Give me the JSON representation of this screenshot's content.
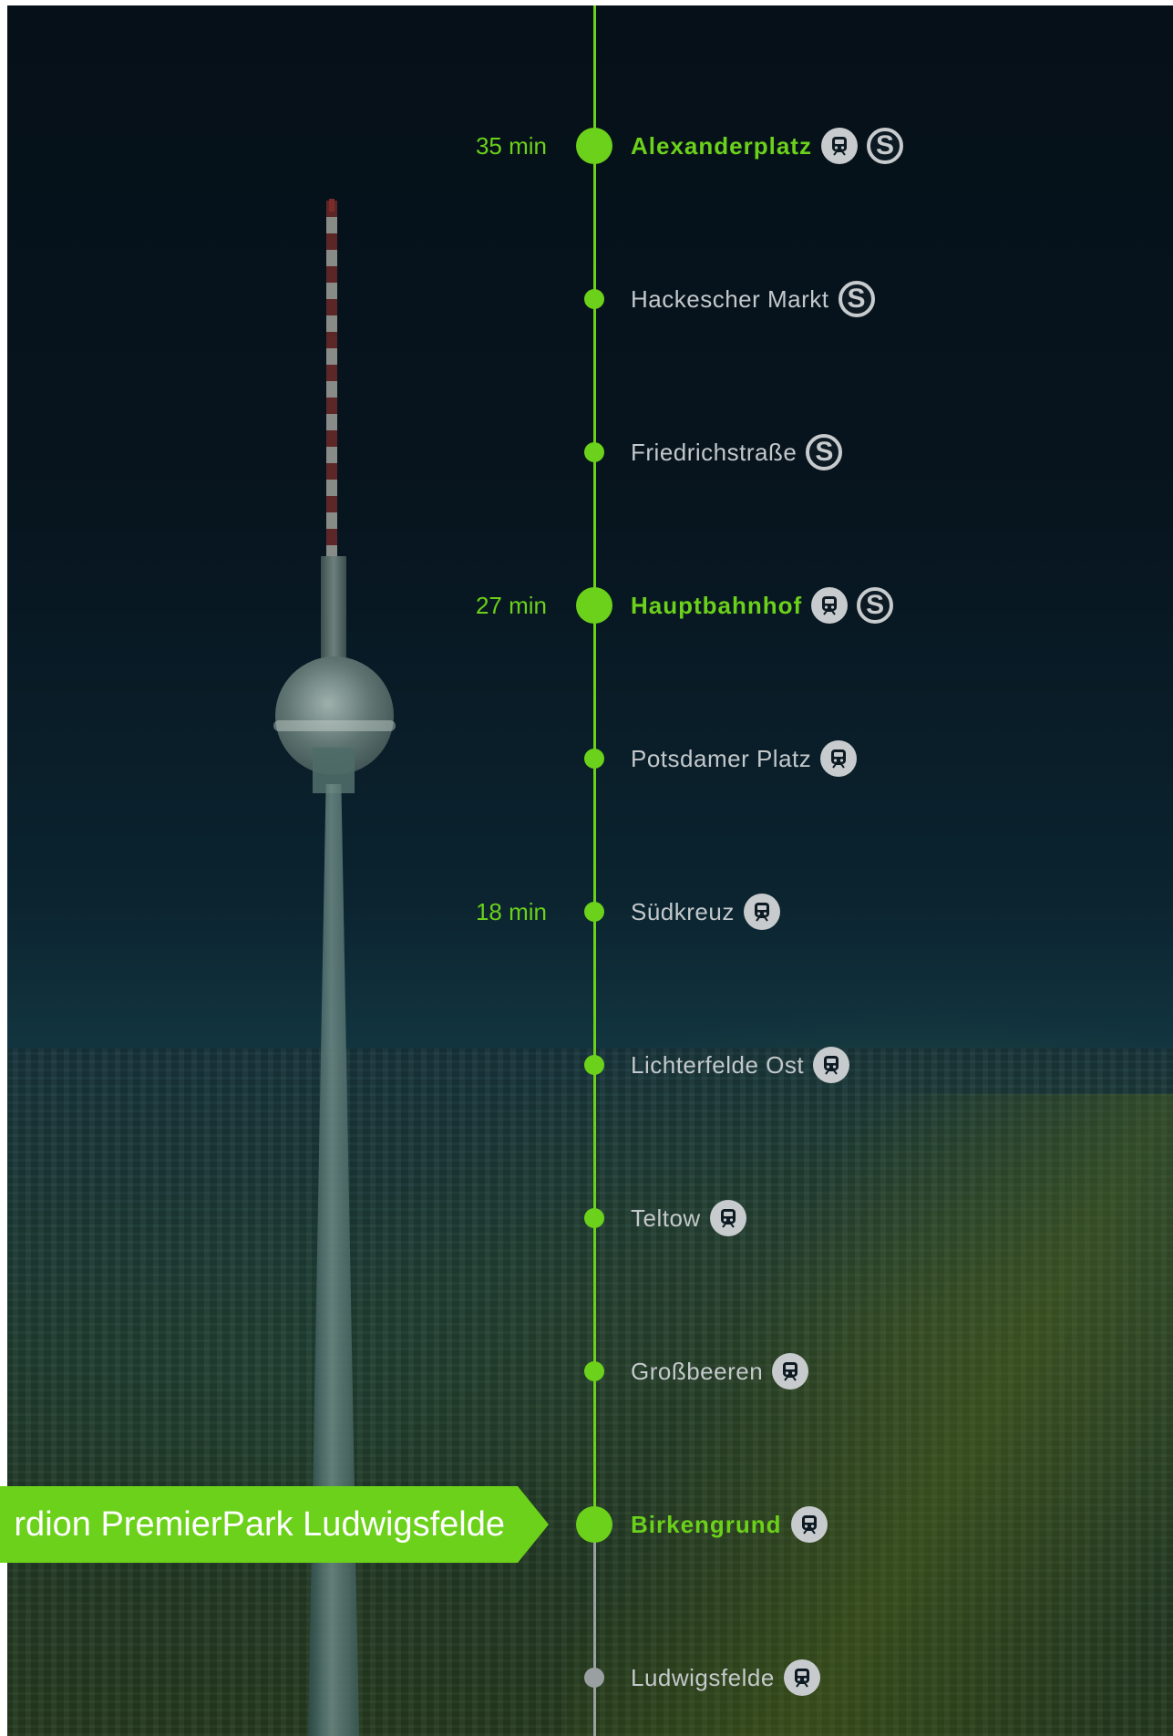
{
  "banner": {
    "text": "rdion PremierPark Ludwigsfelde"
  },
  "colors": {
    "accent": "#6bd11a",
    "inactive_line": "#9aa0a2",
    "station_text": "#c3c8ca",
    "icon_bg": "#c7cbcd"
  },
  "stations": [
    {
      "name": "Alexanderplatz",
      "time": "35 min",
      "major": true,
      "icons": [
        "regional-train-icon",
        "s-bahn-icon"
      ]
    },
    {
      "name": "Hackescher Markt",
      "time": "",
      "major": false,
      "icons": [
        "s-bahn-icon"
      ]
    },
    {
      "name": "Friedrichstraße",
      "time": "",
      "major": false,
      "icons": [
        "s-bahn-icon"
      ]
    },
    {
      "name": "Hauptbahnhof",
      "time": "27 min",
      "major": true,
      "icons": [
        "regional-train-icon",
        "s-bahn-icon"
      ]
    },
    {
      "name": "Potsdamer Platz",
      "time": "",
      "major": false,
      "icons": [
        "regional-train-icon"
      ]
    },
    {
      "name": "Südkreuz",
      "time": "18 min",
      "major": false,
      "icons": [
        "regional-train-icon"
      ]
    },
    {
      "name": "Lichterfelde Ost",
      "time": "",
      "major": false,
      "icons": [
        "regional-train-icon"
      ]
    },
    {
      "name": "Teltow",
      "time": "",
      "major": false,
      "icons": [
        "regional-train-icon"
      ]
    },
    {
      "name": "Großbeeren",
      "time": "",
      "major": false,
      "icons": [
        "regional-train-icon"
      ]
    },
    {
      "name": "Birkengrund",
      "time": "",
      "major": true,
      "icons": [
        "regional-train-icon"
      ]
    },
    {
      "name": "Ludwigsfelde",
      "time": "",
      "major": false,
      "icons": [
        "regional-train-icon"
      ]
    }
  ]
}
